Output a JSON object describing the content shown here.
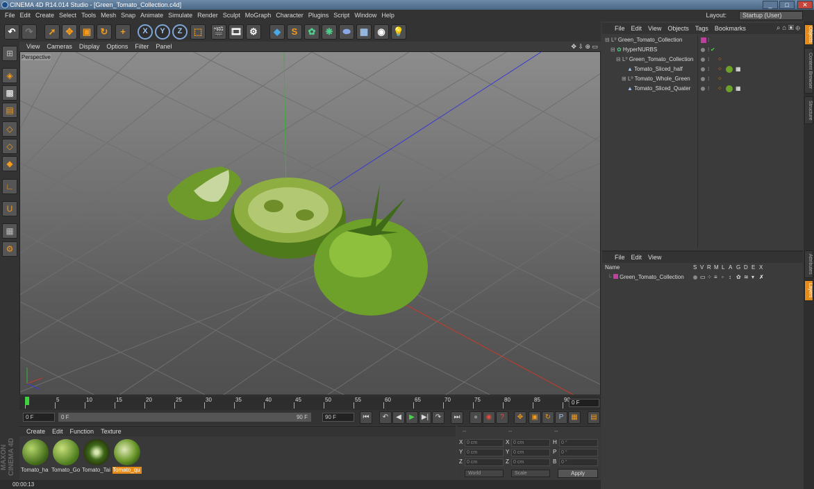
{
  "window": {
    "title": "CINEMA 4D R14.014 Studio - [Green_Tomato_Collection.c4d]",
    "minimize": "_",
    "maximize": "□",
    "close": "✕"
  },
  "menubar": {
    "items": [
      "File",
      "Edit",
      "Create",
      "Select",
      "Tools",
      "Mesh",
      "Snap",
      "Animate",
      "Simulate",
      "Render",
      "Sculpt",
      "MoGraph",
      "Character",
      "Plugins",
      "Script",
      "Window",
      "Help"
    ],
    "layout_label": "Layout:",
    "layout_value": "Startup (User)"
  },
  "toolbar": {
    "icons": [
      "undo-icon",
      "redo-icon",
      "live-select-icon",
      "move-icon",
      "scale-icon",
      "rotate-icon",
      "add-icon",
      "x-axis-icon",
      "y-axis-icon",
      "z-axis-icon",
      "coordinate-system-icon",
      "render-view-icon",
      "render-picture-viewer-icon",
      "edit-render-settings-icon",
      "cube-icon",
      "spline-icon",
      "nurbs-icon",
      "array-icon",
      "deformer-icon",
      "floor-icon",
      "camera-icon",
      "light-icon"
    ],
    "x": "X",
    "y": "Y",
    "z": "Z"
  },
  "viewport": {
    "menu": [
      "View",
      "Cameras",
      "Display",
      "Options",
      "Filter",
      "Panel"
    ],
    "label": "Perspective",
    "nav_icons": "✥ ⇩ ⊕ ▭"
  },
  "timeline": {
    "ticks": [
      "0",
      "5",
      "10",
      "15",
      "20",
      "25",
      "30",
      "35",
      "40",
      "45",
      "50",
      "55",
      "60",
      "65",
      "70",
      "75",
      "80",
      "85",
      "90"
    ],
    "end_frame": "0 F"
  },
  "playbar": {
    "current": "0 F",
    "range_start": "0 F",
    "range_end": "90 F",
    "max": "90 F"
  },
  "materials": {
    "menu": [
      "Create",
      "Edit",
      "Function",
      "Texture"
    ],
    "items": [
      {
        "label": "Tomato_ha",
        "selected": false
      },
      {
        "label": "Tomato_Go",
        "selected": false
      },
      {
        "label": "Tomato_Tai",
        "selected": false
      },
      {
        "label": "Tomato_qu",
        "selected": true
      }
    ]
  },
  "brand": "MAXON CINEMA 4D",
  "coordinates": {
    "headers": [
      "--",
      "--",
      "--"
    ],
    "rows": [
      {
        "a": "X",
        "av": "0 cm",
        "b": "X",
        "bv": "0 cm",
        "c": "H",
        "cv": "0 °"
      },
      {
        "a": "Y",
        "av": "0 cm",
        "b": "Y",
        "bv": "0 cm",
        "c": "P",
        "cv": "0 °"
      },
      {
        "a": "Z",
        "av": "0 cm",
        "b": "Z",
        "bv": "0 cm",
        "c": "B",
        "cv": "0 °"
      }
    ],
    "world": "World",
    "scale": "Scale",
    "apply": "Apply"
  },
  "status": {
    "time": "00:00:13"
  },
  "object_manager": {
    "menu": [
      "File",
      "Edit",
      "View",
      "Objects",
      "Tags",
      "Bookmarks"
    ],
    "objects": [
      {
        "name": "Green_Tomato_Collection",
        "indent": 0,
        "icon": "null-icon"
      },
      {
        "name": "HyperNURBS",
        "indent": 1,
        "icon": "hypernurbs-icon"
      },
      {
        "name": "Green_Tomato_Collection",
        "indent": 2,
        "icon": "null-icon"
      },
      {
        "name": "Tomato_Sliced_half",
        "indent": 3,
        "icon": "polygon-icon"
      },
      {
        "name": "Tomato_Whole_Green",
        "indent": 3,
        "icon": "null-icon"
      },
      {
        "name": "Tomato_Sliced_Quater",
        "indent": 3,
        "icon": "polygon-icon"
      }
    ]
  },
  "layer_manager": {
    "menu": [
      "File",
      "Edit",
      "View"
    ],
    "columns": {
      "name": "Name",
      "flags": [
        "S",
        "V",
        "R",
        "M",
        "L",
        "A",
        "G",
        "D",
        "E",
        "X"
      ]
    },
    "layers": [
      {
        "name": "Green_Tomato_Collection",
        "color": "#c040a0"
      }
    ]
  },
  "side_tabs": [
    "Objects",
    "Content Browser",
    "Structure",
    "Attributes",
    "Layers"
  ]
}
